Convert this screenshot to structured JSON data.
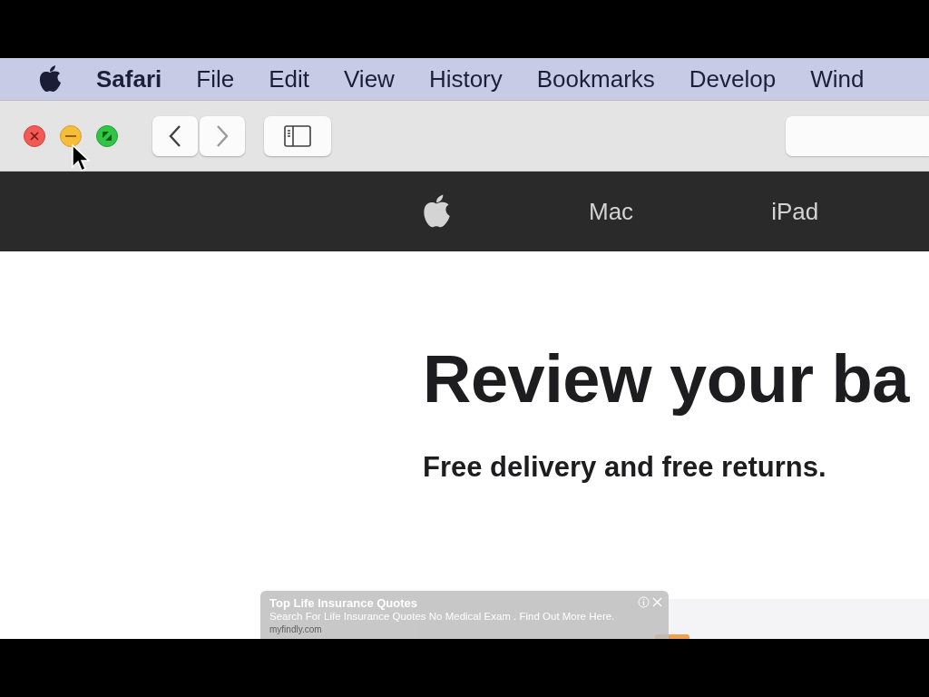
{
  "menu_bar": {
    "items": [
      {
        "label": "Safari",
        "kind": "app"
      },
      {
        "label": "File",
        "kind": "menu"
      },
      {
        "label": "Edit",
        "kind": "menu"
      },
      {
        "label": "View",
        "kind": "menu"
      },
      {
        "label": "History",
        "kind": "menu"
      },
      {
        "label": "Bookmarks",
        "kind": "menu"
      },
      {
        "label": "Develop",
        "kind": "menu"
      },
      {
        "label": "Wind",
        "kind": "menu"
      }
    ]
  },
  "toolbar": {
    "back": {
      "disabled": false
    },
    "forward": {
      "disabled": true
    }
  },
  "site_nav": {
    "items": [
      "Mac",
      "iPad"
    ]
  },
  "page": {
    "heading": "Review your ba",
    "subheading": "Free delivery and free returns."
  },
  "ad": {
    "title": "Top Life Insurance Quotes",
    "text": "Search For Life Insurance Quotes No Medical Exam . Find Out More Here.",
    "domain": "myfindly.com"
  }
}
